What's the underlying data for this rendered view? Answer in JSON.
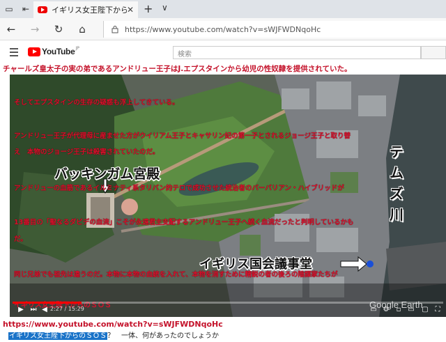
{
  "browser": {
    "tab_title": "イギリス女王陛下からのＳ",
    "address_url": "https://www.youtube.com/watch?v=sWJFWDNqoHc"
  },
  "youtube": {
    "logo_text": "YouTube",
    "logo_region": "JP",
    "search_placeholder": "検索"
  },
  "headline": "チャールズ皇太子の実の弟であるアンドリュー王子はJ.エプスタインから幼児の性奴隷を提供されていた。",
  "overlay_lines": [
    "そしてエプスタインの生存の疑惑も浮上してきている。",
    "アンドリュー王子が代理母に産ませた方がウイリアム王子とキャサリン妃の第一子とされるジョージ王子と取り替",
    "え　本物のジョージ王子は殺害されていたのだ。",
    "アンドリューの血筋であるイルミナティ系タリバン的テロで成功させた統治者のバーバリアン・ハイブリッドが",
    "13番目の「聖なるダビデの血流」こそが永遠君主支配するアンドリュー王子へ続く血流だったと判明しているかも",
    "だ。",
    "同じ兄弟でも祖先は違うのだ。本物に本物の血統を入れて、本物を消すために精鋭の者の後ろの陰謀家たちが"
  ],
  "map_labels": {
    "palace": "バッキンガム宮殿",
    "thames": "テムズ川",
    "parliament": "イギリス国会議事堂",
    "watermark": "Google Earth"
  },
  "player": {
    "video_title": "イギリス女王陛下からのＳＯＳ",
    "time": "2:27 / 15:29",
    "progress": 0.16
  },
  "footer": {
    "url": "https://www.youtube.com/watch?v=sWJFWDNqoHc",
    "selected_text": "イギリス女王陛下からのＳＯＳ",
    "rest_text": "？　一体、何があったのでしょうか"
  }
}
